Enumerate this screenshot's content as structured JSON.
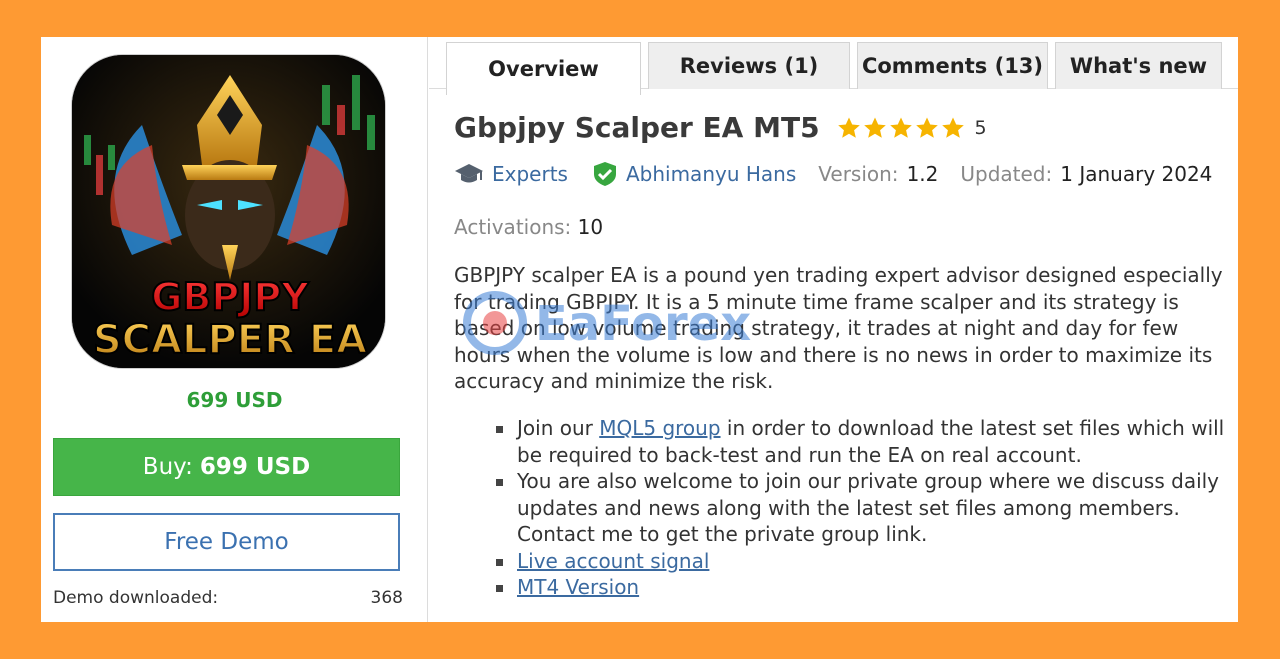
{
  "product": {
    "image_text_line1": "GBPJPY",
    "image_text_line2": "SCALPER EA",
    "price": "699 USD",
    "buy_label": "Buy:",
    "buy_price": "699 USD",
    "demo_label": "Free Demo",
    "demo_downloaded_label": "Demo downloaded:",
    "demo_downloaded_value": "368"
  },
  "tabs": [
    {
      "label": "Overview",
      "active": true
    },
    {
      "label": "Reviews (1)",
      "active": false
    },
    {
      "label": "Comments (13)",
      "active": false
    },
    {
      "label": "What's new",
      "active": false
    }
  ],
  "header": {
    "title": "Gbpjpy Scalper EA MT5",
    "rating": "5",
    "stars": 5
  },
  "meta": {
    "category": "Experts",
    "author": "Abhimanyu Hans",
    "version_label": "Version:",
    "version_value": "1.2",
    "updated_label": "Updated:",
    "updated_value": "1 January 2024",
    "activations_label": "Activations:",
    "activations_value": "10"
  },
  "description": "GBPJPY scalper EA is a pound yen trading expert advisor designed especially for trading GBPJPY. It is a 5 minute time frame scalper and its strategy is based on low volume trading strategy, it trades at night and day for few hours when the volume is low and there is no news in order to maximize its accuracy and minimize the risk.",
  "bullets": {
    "b1_pre": "Join our ",
    "b1_link": "MQL5 group",
    "b1_post": " in order to download the latest set files which will be required to back-test and run the EA on real account.",
    "b2": "You are also welcome to join our private group where we discuss daily updates and news along with the latest set files among members. Contact me to get the private group link.",
    "b3_link": "Live account signal",
    "b4_link": "MT4 Version"
  },
  "watermark": "EaForex",
  "colors": {
    "background": "#fe9a33",
    "price_green": "#2e9e38",
    "buy_green": "#46b549",
    "link_blue": "#3b6aa0",
    "star_gold": "#f6b400"
  }
}
